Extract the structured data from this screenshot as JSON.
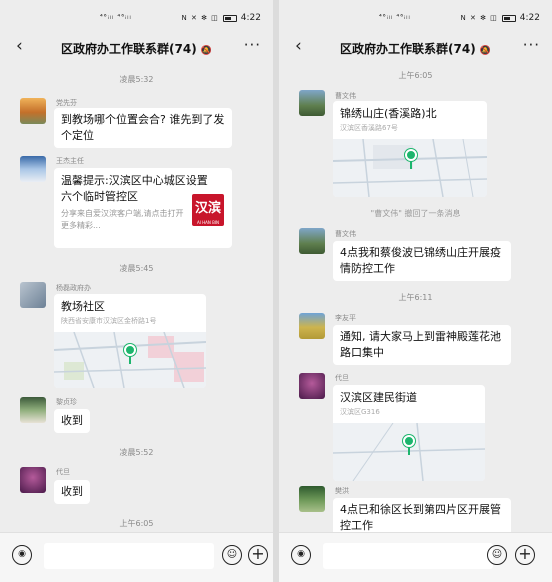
{
  "left": {
    "status": {
      "signal": "⁴⁶ᵢₗₗ ⁴⁶ᵢₗₗ",
      "icons": "N ✕ ✻ ◫",
      "time": "4:22"
    },
    "header": {
      "back": "‹",
      "title": "区政府办工作联系群(74)",
      "mute": "🔕",
      "more": "···"
    },
    "messages": {
      "ts1": "凌晨5:32",
      "m1_sender": "党先芬",
      "m1_text": "到教场哪个位置会合? 谁先到了发个定位",
      "m2_sender": "王杰主任",
      "m2_title": "温馨提示:汉滨区中心城区设置六个临时管控区",
      "m2_preview": "分享来自爱汉滨客户端,请点击打开更多精彩...",
      "m2_thumb": "汉滨",
      "m2_thumb_small": "AI HAN BIN",
      "ts2": "凌晨5:45",
      "m3_sender": "杨磊政府办",
      "m3_title": "教场社区",
      "m3_sub": "陕西省安康市汉滨区金桥路1号",
      "m4_sender": "黎贞珍",
      "m4_text": "收到",
      "ts3": "凌晨5:52",
      "m5_sender": "代旦",
      "m5_text": "收到",
      "ts4": "上午6:05"
    }
  },
  "right": {
    "status": {
      "signal": "⁴⁶ᵢₗₗ ⁴⁶ᵢₗₗ",
      "icons": "N ✕ ✻ ◫",
      "time": "4:22"
    },
    "header": {
      "back": "‹",
      "title": "区政府办工作联系群(74)",
      "mute": "🔕",
      "more": "···"
    },
    "messages": {
      "ts1": "上午6:05",
      "m1_sender": "曹文伟",
      "m1_title": "锦绣山庄(香溪路)北",
      "m1_sub": "汉滨区香溪路67号",
      "sys": "\"曹文伟\" 撤回了一条消息",
      "m2_sender": "曹文伟",
      "m2_text": "4点我和蔡俊波已锦绣山庄开展疫情防控工作",
      "ts2": "上午6:11",
      "m3_sender": "李友平",
      "m3_text": "通知, 请大家马上到雷神殿莲花池路口集中",
      "m4_sender": "代旦",
      "m4_title": "汉滨区建民街道",
      "m4_sub": "汉滨区G316",
      "m5_sender": "樊洪",
      "m5_text": "4点已和徐区长到第四片区开展管控工作"
    }
  },
  "input": {
    "voice": "◉",
    "emoji": "☺",
    "plus": "+"
  }
}
